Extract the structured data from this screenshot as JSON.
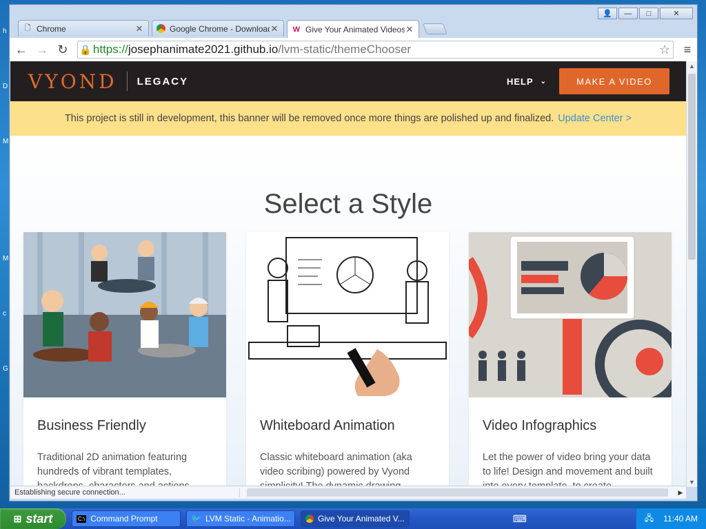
{
  "window": {
    "controls": {
      "user": "👤",
      "minimize": "—",
      "maximize": "□",
      "close": "✕"
    }
  },
  "tabs": [
    {
      "label": "Chrome",
      "icon": "page-icon"
    },
    {
      "label": "Google Chrome - Download t",
      "icon": "chrome-icon"
    },
    {
      "label": "Give Your Animated Videos t",
      "icon": "vyond-icon"
    }
  ],
  "address_bar": {
    "scheme": "https://",
    "host": "josephanimate2021.github.io",
    "path": "/lvm-static/themeChooser"
  },
  "site": {
    "logo": "VYOND",
    "logo_sub": "LEGACY",
    "help": "HELP",
    "cta": "MAKE A VIDEO"
  },
  "banner": {
    "text": "This project is still in development, this banner will be removed once more things are polished up and finalized.",
    "link": "Update Center >"
  },
  "page": {
    "title": "Select a Style",
    "cards": [
      {
        "title": "Business Friendly",
        "desc": "Traditional 2D animation featuring hundreds of vibrant templates, backdrops, characters and actions."
      },
      {
        "title": "Whiteboard Animation",
        "desc": "Classic whiteboard animation (aka video scribing) powered by Vyond simplicity! The dynamic drawing"
      },
      {
        "title": "Video Infographics",
        "desc": "Let the power of video bring your data to life! Design and movement and built into every template, to create"
      }
    ]
  },
  "status": {
    "text": "Establishing secure connection..."
  },
  "taskbar": {
    "start": "start",
    "tasks": [
      {
        "label": "Command Prompt",
        "icon": "cmd-icon"
      },
      {
        "label": "LVM Static - Animatio...",
        "icon": "app-icon"
      },
      {
        "label": "Give Your Animated V...",
        "icon": "chrome-icon"
      }
    ],
    "clock": "11:40 AM"
  }
}
